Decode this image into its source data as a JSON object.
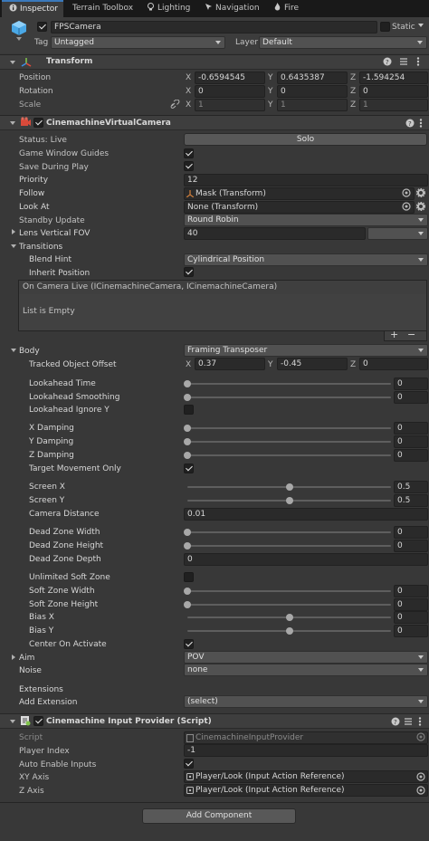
{
  "tabs": [
    {
      "label": "Inspector",
      "icon": "info-icon"
    },
    {
      "label": "Terrain Toolbox",
      "icon": ""
    },
    {
      "label": "Lighting",
      "icon": "lightbulb-icon"
    },
    {
      "label": "Navigation",
      "icon": "navigation-icon"
    },
    {
      "label": "Fire",
      "icon": "fire-icon"
    }
  ],
  "header": {
    "name": "FPSCamera",
    "static_label": "Static",
    "tag_label": "Tag",
    "tag_value": "Untagged",
    "layer_label": "Layer",
    "layer_value": "Default"
  },
  "transform": {
    "title": "Transform",
    "position_label": "Position",
    "rotation_label": "Rotation",
    "scale_label": "Scale",
    "position": {
      "x": "-0.6594545",
      "y": "0.6435387",
      "z": "-1.594254"
    },
    "rotation": {
      "x": "0",
      "y": "0",
      "z": "0"
    },
    "scale": {
      "x": "1",
      "y": "1",
      "z": "1"
    },
    "axis_x": "X",
    "axis_y": "Y",
    "axis_z": "Z"
  },
  "vcam": {
    "title": "CinemachineVirtualCamera",
    "status_label": "Status: Live",
    "solo_label": "Solo",
    "game_window_guides": "Game Window Guides",
    "save_during_play": "Save During Play",
    "priority_label": "Priority",
    "priority_value": "12",
    "follow_label": "Follow",
    "follow_value": "Mask (Transform)",
    "lookat_label": "Look At",
    "lookat_value": "None (Transform)",
    "standby_label": "Standby Update",
    "standby_value": "Round Robin",
    "lens_label": "Lens Vertical FOV",
    "lens_value": "40",
    "transitions_label": "Transitions",
    "blend_hint_label": "Blend Hint",
    "blend_hint_value": "Cylindrical Position",
    "inherit_position_label": "Inherit Position",
    "event_header": "On Camera Live (ICinemachineCamera, ICinemachineCamera)",
    "list_empty": "List is Empty",
    "plus": "+",
    "minus": "−"
  },
  "body": {
    "label": "Body",
    "value": "Framing Transposer",
    "tracked_offset_label": "Tracked Object Offset",
    "tracked_offset": {
      "x": "0.37",
      "y": "-0.45",
      "z": "0"
    },
    "rows": [
      {
        "label": "Lookahead Time",
        "value": "0",
        "type": "slider",
        "pos": 0
      },
      {
        "label": "Lookahead Smoothing",
        "value": "0",
        "type": "slider",
        "pos": 0
      },
      {
        "label": "Lookahead Ignore Y",
        "type": "check",
        "checked": false
      },
      {
        "label": "X Damping",
        "value": "0",
        "type": "slider",
        "pos": 0
      },
      {
        "label": "Y Damping",
        "value": "0",
        "type": "slider",
        "pos": 0
      },
      {
        "label": "Z Damping",
        "value": "0",
        "type": "slider",
        "pos": 0
      },
      {
        "label": "Target Movement Only",
        "type": "check",
        "checked": true
      },
      {
        "label": "Screen X",
        "value": "0.5",
        "type": "slider",
        "pos": 0.5
      },
      {
        "label": "Screen Y",
        "value": "0.5",
        "type": "slider",
        "pos": 0.5
      },
      {
        "label": "Camera Distance",
        "value": "0.01",
        "type": "field"
      },
      {
        "label": "Dead Zone Width",
        "value": "0",
        "type": "slider",
        "pos": 0
      },
      {
        "label": "Dead Zone Height",
        "value": "0",
        "type": "slider",
        "pos": 0
      },
      {
        "label": "Dead Zone Depth",
        "value": "0",
        "type": "field"
      },
      {
        "label": "Unlimited Soft Zone",
        "type": "check",
        "checked": false
      },
      {
        "label": "Soft Zone Width",
        "value": "0",
        "type": "slider",
        "pos": 0
      },
      {
        "label": "Soft Zone Height",
        "value": "0",
        "type": "slider",
        "pos": 0
      },
      {
        "label": "Bias X",
        "value": "0",
        "type": "slider",
        "pos": 0.5
      },
      {
        "label": "Bias Y",
        "value": "0",
        "type": "slider",
        "pos": 0.5
      },
      {
        "label": "Center On Activate",
        "type": "check",
        "checked": true
      }
    ]
  },
  "aim": {
    "label": "Aim",
    "value": "POV"
  },
  "noise": {
    "label": "Noise",
    "value": "none"
  },
  "extensions": {
    "label": "Extensions",
    "add_label": "Add Extension",
    "add_value": "(select)"
  },
  "input_provider": {
    "title": "Cinemachine Input Provider (Script)",
    "script_label": "Script",
    "script_value": "CinemachineInputProvider",
    "player_index_label": "Player Index",
    "player_index_value": "-1",
    "auto_enable_label": "Auto Enable Inputs",
    "xy_label": "XY Axis",
    "xy_value": "Player/Look (Input Action Reference)",
    "z_label": "Z Axis",
    "z_value": "Player/Look (Input Action Reference)"
  },
  "add_component": "Add Component",
  "colors": {
    "accent": "#3a79bb",
    "background": "#383838",
    "header": "#3e3e3e",
    "field": "#2a2a2a"
  }
}
